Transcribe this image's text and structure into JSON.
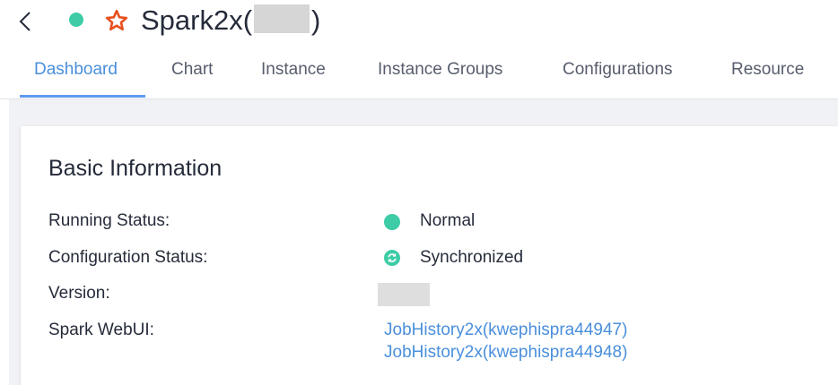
{
  "header": {
    "title_prefix": "Spark2x(",
    "title_suffix": ")",
    "status_color": "#3dcca6",
    "star_color": "#e8501e",
    "back_icon": "chevron-left-icon",
    "favorite_icon": "star-outline-icon"
  },
  "tabs": [
    {
      "label": "Dashboard",
      "active": true
    },
    {
      "label": "Chart",
      "active": false
    },
    {
      "label": "Instance",
      "active": false
    },
    {
      "label": "Instance Groups",
      "active": false
    },
    {
      "label": "Configurations",
      "active": false
    },
    {
      "label": "Resource",
      "active": false
    }
  ],
  "basic_info": {
    "title": "Basic Information",
    "running_status_label": "Running Status:",
    "running_status_value": "Normal",
    "config_status_label": "Configuration Status:",
    "config_status_value": "Synchronized",
    "version_label": "Version:",
    "webui_label": "Spark WebUI:",
    "webui_links": [
      "JobHistory2x(kwephispra44947)",
      "JobHistory2x(kwephispra44948)"
    ]
  },
  "colors": {
    "accent": "#4a8fdc",
    "status_normal": "#3dcca6"
  }
}
